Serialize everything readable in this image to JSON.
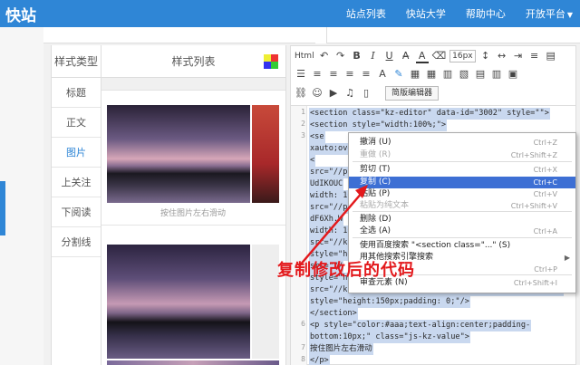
{
  "header": {
    "logo": "快站",
    "nav": [
      "站点列表",
      "快站大学",
      "帮助中心",
      "开放平台"
    ],
    "accent": "#2f86d6"
  },
  "types_panel": {
    "title": "样式类型",
    "items": [
      "标题",
      "正文",
      "图片",
      "上关注",
      "下阅读",
      "分割线"
    ],
    "active_index": 2
  },
  "style_list": {
    "title": "样式列表",
    "caption": "按住图片左右滑动"
  },
  "toolbar": {
    "html_btn": "Html",
    "undo": "↶",
    "redo": "↷",
    "bold": "B",
    "italic": "I",
    "underline": "U",
    "strike": "A̶",
    "font_color": "A",
    "font_size": "16px",
    "simple_editor": "简版编辑器"
  },
  "code": {
    "lines": [
      {
        "n": "1",
        "text": "<section class=\"kz-editor\" data-id=\"3002\" style=\"\">"
      },
      {
        "n": "2",
        "text": "  <section style=\"width:100%;\">"
      },
      {
        "n": "3",
        "text": "    <se"
      },
      {
        "n": "",
        "text": "xauto;ove"
      },
      {
        "n": "",
        "text": "    <"
      },
      {
        "n": "",
        "text": "src=\"//pi"
      },
      {
        "n": "",
        "text": "UdIKOUC"
      },
      {
        "n": "",
        "text": "width: 10"
      },
      {
        "n": "",
        "text": "src=\"//pi"
      },
      {
        "n": "",
        "text": "dF6Xh.W"
      },
      {
        "n": "",
        "text": "width: 10"
      },
      {
        "n": "",
        "text": "src=\"//kz"
      },
      {
        "n": "",
        "text": "style=\"he"
      },
      {
        "n": "",
        "text": "src=\"//"
      },
      {
        "n": "",
        "text": "style=\"he"
      },
      {
        "n": "",
        "text": "src=\"//kzcdn.itc.cn/res/kzeditor/images/2-5.jpg?v=5.0\""
      },
      {
        "n": "",
        "text": "style=\"height:150px;padding: 0;\"/>"
      },
      {
        "n": "",
        "text": "    </section>"
      },
      {
        "n": "6",
        "text": "    <p style=\"color:#aaa;text-align:center;padding-"
      },
      {
        "n": "",
        "text": "bottom:10px;\" class=\"js-kz-value\">"
      },
      {
        "n": "7",
        "text": "      按住图片左右滑动"
      },
      {
        "n": "8",
        "text": "    </p>"
      }
    ]
  },
  "context_menu": {
    "items": [
      {
        "label": "撤消 (U)",
        "shortcut": "Ctrl+Z",
        "state": "normal"
      },
      {
        "label": "重做 (R)",
        "shortcut": "Ctrl+Shift+Z",
        "state": "disabled"
      },
      {
        "label": "剪切 (T)",
        "shortcut": "Ctrl+X",
        "state": "normal"
      },
      {
        "label": "复制 (C)",
        "shortcut": "Ctrl+C",
        "state": "selected"
      },
      {
        "label": "粘贴 (P)",
        "shortcut": "Ctrl+V",
        "state": "normal"
      },
      {
        "label": "粘贴为纯文本",
        "shortcut": "Ctrl+Shift+V",
        "state": "disabled"
      },
      {
        "label": "删除 (D)",
        "shortcut": "",
        "state": "normal"
      },
      {
        "label": "全选 (A)",
        "shortcut": "Ctrl+A",
        "state": "normal"
      },
      {
        "label": "使用百度搜索 \"<section class=\"...\" (S)",
        "shortcut": "",
        "state": "normal"
      },
      {
        "label": "用其他搜索引擎搜索",
        "shortcut": "",
        "state": "normal"
      },
      {
        "label": "",
        "shortcut": "Ctrl+P",
        "state": "normal"
      },
      {
        "label": "审查元素 (N)",
        "shortcut": "Ctrl+Shift+I",
        "state": "normal"
      }
    ]
  },
  "annotation": {
    "text": "复制修改后的代码",
    "color": "#e3191c"
  }
}
